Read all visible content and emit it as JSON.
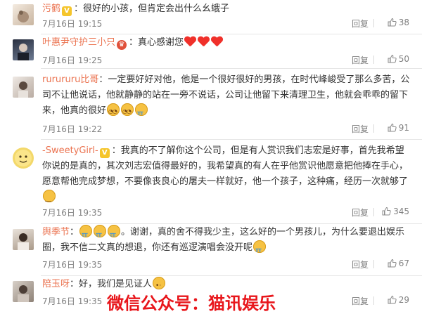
{
  "comments": [
    {
      "user": "污鹤",
      "badge": "vip-yellow",
      "text": "：很好的小孩，但肯定会出什么幺蛾子",
      "time": "7月16日 19:15",
      "reply": "回复",
      "likes": "38"
    },
    {
      "user": "叶惠尹守护三小只",
      "badge": "vip-red",
      "text": "：真心感谢您",
      "emojis": [
        "heart-icon",
        "heart-icon",
        "heart-icon"
      ],
      "time": "7月16日 19:25",
      "reply": "回复",
      "likes": "50"
    },
    {
      "user": "rurururu比哥",
      "text": "：一定要好好对他，他是一个很好很好的男孩，在时代峰峻受了那么多苦，公司不让他说话，他就静静的站在一旁不说话，公司让他留下来清理卫生，他就会乖乖的留下来，他真的很好",
      "emojis": [
        "sweat-smile-icon",
        "sweat-smile-icon",
        "crying-face-icon"
      ],
      "time": "7月16日 19:22",
      "reply": "回复",
      "likes": "91"
    },
    {
      "user": "-SweetyGirl-",
      "badge": "vip-yellow",
      "text": "：我真的不了解你这个公司，但是有人赏识我们志宏是好事，首先我希望你说的是真的，其次刘志宏值得最好的，我希望真的有人在乎他赏识他愿意把他捧在手心，愿意帮他完成梦想，不要像丧良心的屠夫一样就好，他一个孩子，这种痛，经历一次就够了",
      "emojis": [
        "sad-face-icon"
      ],
      "time": "7月16日 19:35",
      "reply": "回复",
      "likes": "345"
    },
    {
      "user": "舆季节",
      "text": "：",
      "emojis_lead": [
        "crying-face-icon",
        "crying-face-icon",
        "crying-face-icon"
      ],
      "text2": "。谢谢，真的舍不得我少主，这么好的一个男孩儿，为什么要退出娱乐圈，我不信二文真的想退，你还有巡逻演唱会没开呢",
      "emojis": [
        "crying-face-icon"
      ],
      "time": "7月16日 19:35",
      "reply": "回复",
      "likes": "67"
    },
    {
      "user": "陪玉呀",
      "text": "：好，我们是见证人",
      "emojis": [
        "sweat-icon"
      ],
      "time": "7月16日 19:35",
      "reply": "回复",
      "likes": "29"
    }
  ],
  "watermark": "微信公众号：猫讯娱乐",
  "colors": {
    "username": "#eb7350",
    "watermark": "#e8161b",
    "meta": "#808080"
  }
}
